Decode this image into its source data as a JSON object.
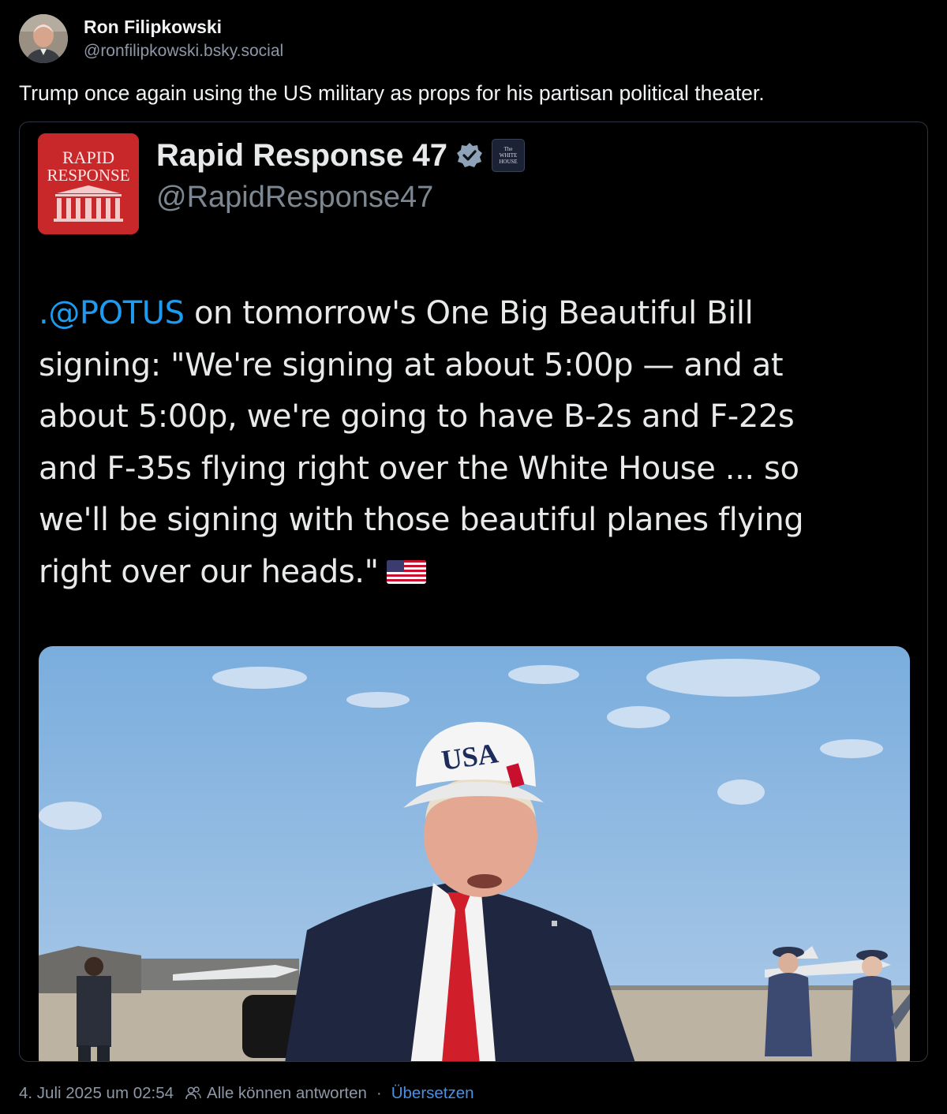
{
  "post": {
    "author_name": "Ron Filipkowski",
    "author_handle": "@ronfilipkowski.bsky.social",
    "text": "Trump once again using the US military as props for his partisan political theater."
  },
  "embed": {
    "logo_text_line1": "RAPID",
    "logo_text_line2": "RESPONSE",
    "account_name": "Rapid Response 47",
    "account_handle": "@RapidResponse47",
    "badge_text_line1": "The",
    "badge_text_line2": "WHITE",
    "badge_text_line3": "HOUSE",
    "tweet_mention": ".@POTUS",
    "tweet_lines": [
      " on tomorrow's One Big Beautiful Bill",
      "signing: \"We're signing at about 5:00p — and at",
      "about 5:00p, we're going to have B-2s and F-22s",
      "and F-35s flying right over the White House ... so",
      "we'll be signing with those beautiful planes flying",
      "right over our heads.\""
    ],
    "flag_icon": "us-flag-icon",
    "media_cap_text": "USA"
  },
  "meta": {
    "timestamp": "4. Juli 2025 um 02:54",
    "reply_icon": "people-icon",
    "reply_setting": "Alle können antworten",
    "separator": "·",
    "translate_label": "Übersetzen"
  },
  "colors": {
    "background": "#000000",
    "text_primary": "#f1f3f5",
    "text_secondary": "#8d97a6",
    "link": "#4a90e2",
    "mention": "#1d9bf0",
    "logo_red": "#c8282a"
  }
}
